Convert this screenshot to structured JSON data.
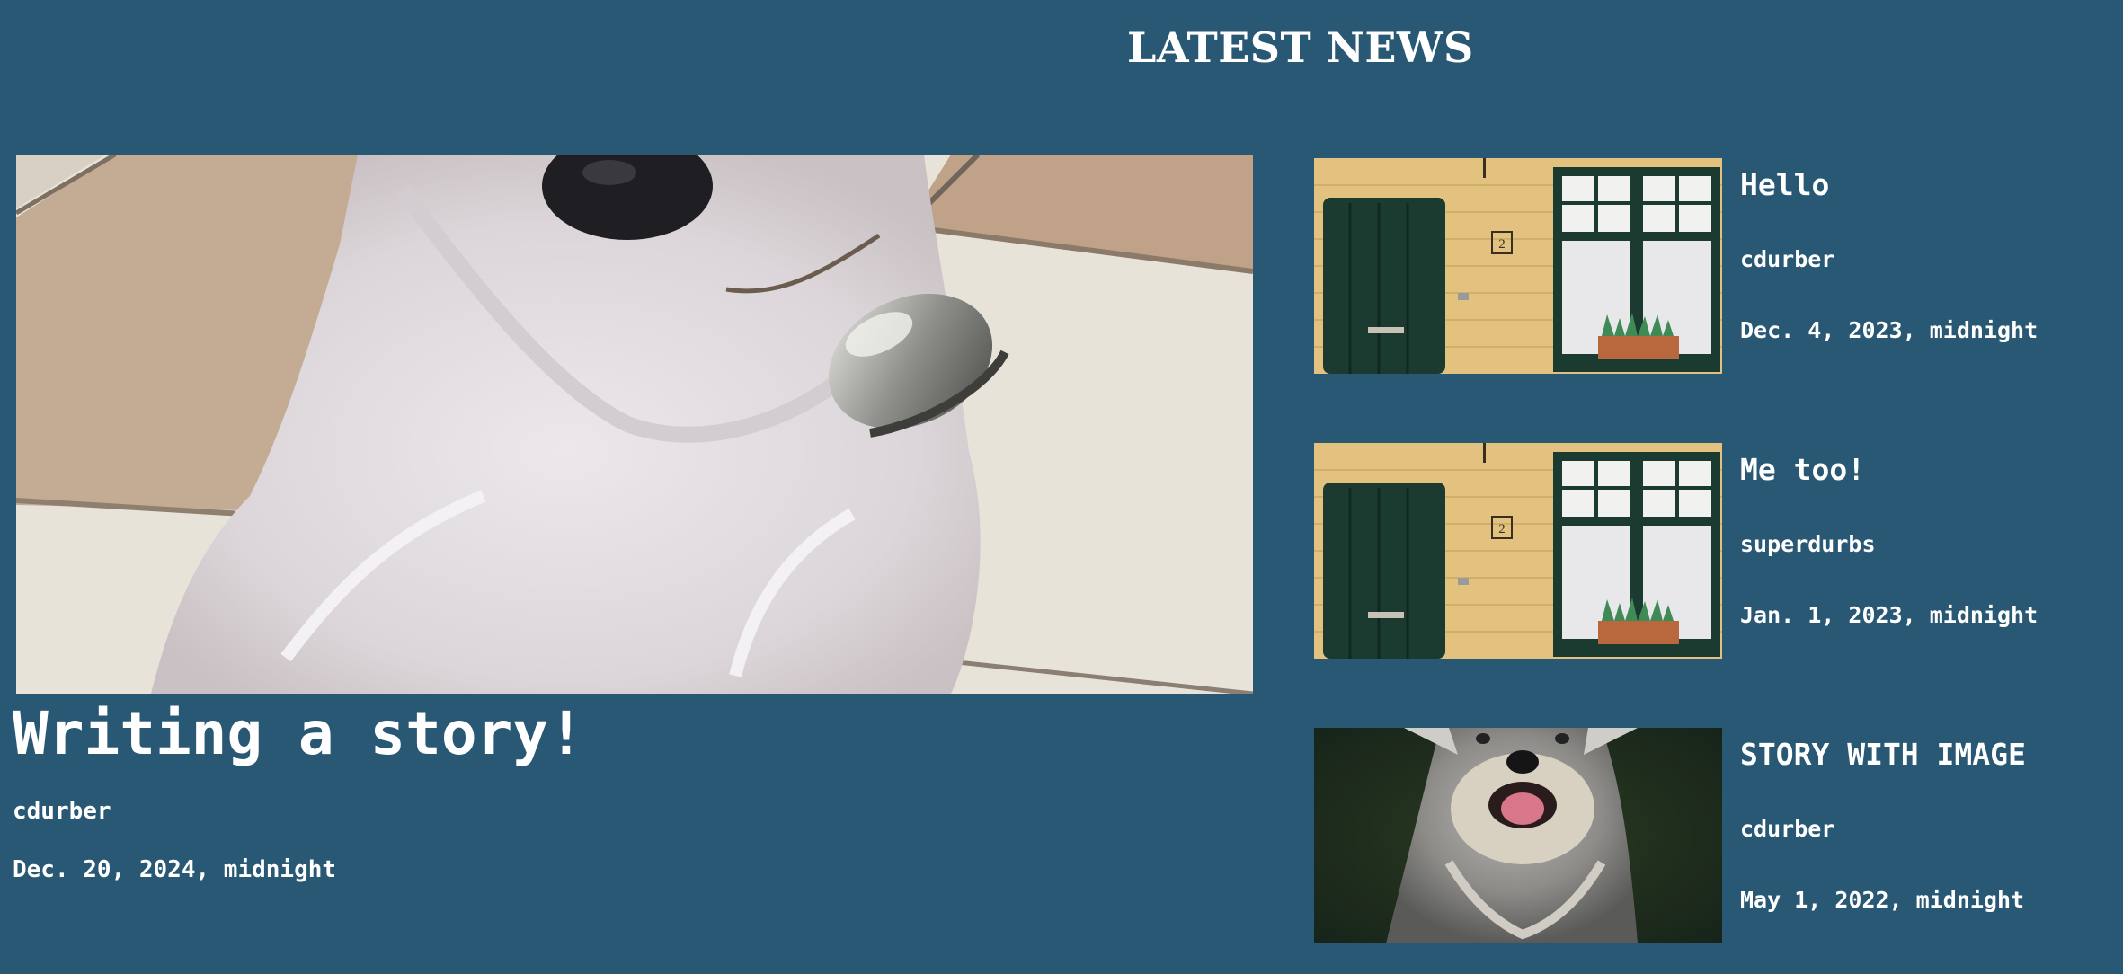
{
  "header": {
    "title": "LATEST NEWS"
  },
  "featured": {
    "title": "Writing a story!",
    "author": "cdurber",
    "date": "Dec. 20, 2024, midnight",
    "image_icon": "white-dog-with-bell-photo"
  },
  "stories": [
    {
      "title": "Hello",
      "author": "cdurber",
      "date": "Dec. 4, 2023, midnight",
      "image_icon": "house-facade-photo",
      "door_number": "2"
    },
    {
      "title": "Me too!",
      "author": "superdurbs",
      "date": "Jan. 1, 2023, midnight",
      "image_icon": "house-facade-photo",
      "door_number": "2"
    },
    {
      "title": "STORY WITH IMAGE",
      "author": "cdurber",
      "date": "May 1, 2022, midnight",
      "image_icon": "schnauzer-dog-photo"
    }
  ],
  "colors": {
    "background": "#295874",
    "text": "#ffffff"
  }
}
